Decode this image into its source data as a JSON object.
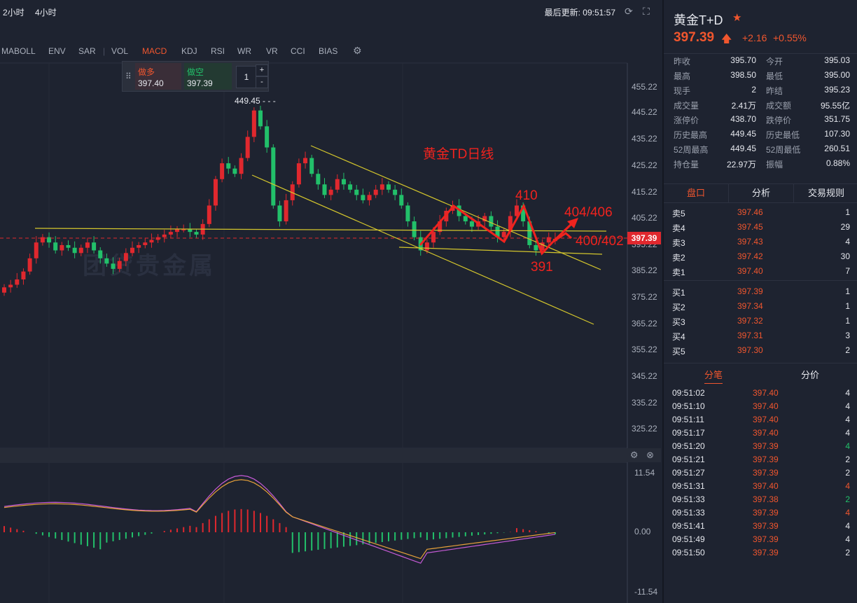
{
  "topbar": {
    "timeframes": [
      "2小时",
      "4小时"
    ],
    "update_text": "最后更新: 09:51:57"
  },
  "indicators": [
    "MABOLL",
    "ENV",
    "SAR",
    "|",
    "VOL",
    "MACD",
    "KDJ",
    "RSI",
    "WR",
    "VR",
    "CCI",
    "BIAS"
  ],
  "active_indicator": "MACD",
  "trade": {
    "long_label": "做多",
    "long_price": "397.40",
    "short_label": "做空",
    "short_price": "397.39",
    "qty": "1",
    "plus": "+",
    "minus": "-"
  },
  "chart": {
    "title": "黄金TD日线",
    "y_ticks": [
      "455.22",
      "445.22",
      "435.22",
      "425.22",
      "415.22",
      "405.22",
      "395.22",
      "385.22",
      "375.22",
      "365.22",
      "355.22",
      "345.22",
      "335.22",
      "325.22"
    ],
    "current_price": "397.39",
    "peak_label": "449.45",
    "annotations": {
      "a410": "410",
      "a391": "391",
      "a404": "404/406",
      "a400": "400/402"
    },
    "watermark": "团贷贵金属",
    "macd_ticks": [
      "11.54",
      "0.00",
      "-11.54"
    ]
  },
  "chart_data": {
    "type": "candlestick",
    "title": "黄金TD日线",
    "ylim": [
      320,
      460
    ],
    "last_price": 397.39,
    "high": 449.45,
    "closes": [
      379,
      380,
      382,
      385,
      390,
      396,
      398,
      396,
      393,
      395,
      394,
      392,
      394,
      396,
      393,
      390,
      388,
      386,
      389,
      392,
      394,
      395,
      396,
      397,
      398,
      399,
      400,
      401,
      401,
      400,
      399,
      403,
      410,
      420,
      426,
      424,
      422,
      428,
      436,
      446,
      440,
      432,
      410,
      404,
      412,
      418,
      426,
      428,
      422,
      418,
      414,
      416,
      420,
      418,
      416,
      414,
      412,
      414,
      416,
      418,
      416,
      414,
      410,
      404,
      398,
      393,
      396,
      400,
      404,
      408,
      410,
      406,
      404,
      402,
      404,
      406,
      402,
      398,
      400,
      406,
      410,
      404,
      395,
      393,
      396,
      398,
      397.39
    ],
    "macd_ylim": [
      -11.54,
      11.54
    ],
    "colors": {
      "up": "#e0282e",
      "down": "#22c06a",
      "trend": "#d4c62c",
      "annot": "#f0231e"
    }
  },
  "panel": {
    "title": "黄金T+D",
    "price": "397.39",
    "change": "+2.16",
    "pct": "+0.55%",
    "stats": [
      [
        "昨收",
        "395.70",
        "今开",
        "395.03"
      ],
      [
        "最高",
        "398.50",
        "最低",
        "395.00"
      ],
      [
        "现手",
        "2",
        "昨结",
        "395.23"
      ],
      [
        "成交量",
        "2.41万",
        "成交额",
        "95.55亿"
      ],
      [
        "涨停价",
        "438.70",
        "跌停价",
        "351.75"
      ],
      [
        "历史最高",
        "449.45",
        "历史最低",
        "107.30"
      ],
      [
        "52周最高",
        "449.45",
        "52周最低",
        "260.51"
      ],
      [
        "持仓量",
        "22.97万",
        "振幅",
        "0.88%"
      ]
    ],
    "tabs": [
      "盘口",
      "分析",
      "交易规则"
    ],
    "asks": [
      [
        "卖5",
        "397.46",
        "1"
      ],
      [
        "卖4",
        "397.45",
        "29"
      ],
      [
        "卖3",
        "397.43",
        "4"
      ],
      [
        "卖2",
        "397.42",
        "30"
      ],
      [
        "卖1",
        "397.40",
        "7"
      ]
    ],
    "bids": [
      [
        "买1",
        "397.39",
        "1"
      ],
      [
        "买2",
        "397.34",
        "1"
      ],
      [
        "买3",
        "397.32",
        "1"
      ],
      [
        "买4",
        "397.31",
        "3"
      ],
      [
        "买5",
        "397.30",
        "2"
      ]
    ],
    "tabs2": [
      "分笔",
      "分价"
    ],
    "trades": [
      [
        "09:51:02",
        "397.40",
        "4",
        "w"
      ],
      [
        "09:51:10",
        "397.40",
        "4",
        "w"
      ],
      [
        "09:51:11",
        "397.40",
        "4",
        "w"
      ],
      [
        "09:51:17",
        "397.40",
        "4",
        "w"
      ],
      [
        "09:51:20",
        "397.39",
        "4",
        "g"
      ],
      [
        "09:51:21",
        "397.39",
        "2",
        "w"
      ],
      [
        "09:51:27",
        "397.39",
        "2",
        "w"
      ],
      [
        "09:51:31",
        "397.40",
        "4",
        "r"
      ],
      [
        "09:51:33",
        "397.38",
        "2",
        "g"
      ],
      [
        "09:51:33",
        "397.39",
        "4",
        "r"
      ],
      [
        "09:51:41",
        "397.39",
        "4",
        "w"
      ],
      [
        "09:51:49",
        "397.39",
        "4",
        "w"
      ],
      [
        "09:51:50",
        "397.39",
        "2",
        "w"
      ]
    ]
  }
}
